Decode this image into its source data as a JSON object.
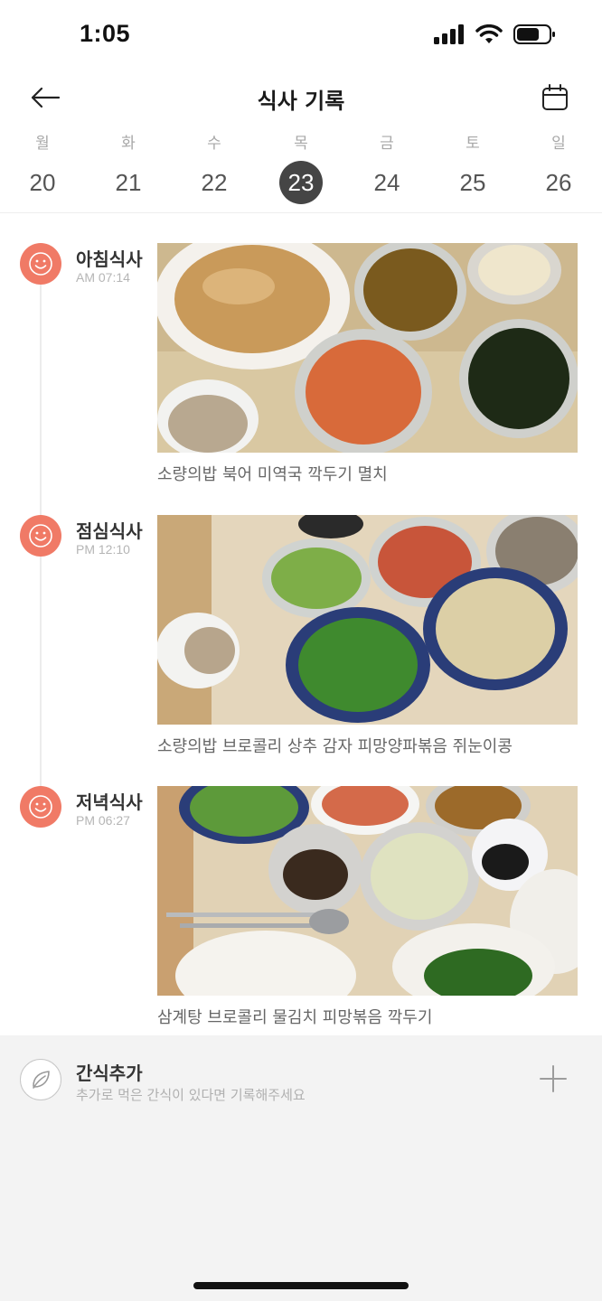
{
  "status_bar": {
    "time": "1:05"
  },
  "header": {
    "title": "식사 기록",
    "back_icon": "arrow-left-icon",
    "calendar_icon": "calendar-icon"
  },
  "week": {
    "days": [
      {
        "dow": "월",
        "date": "20",
        "selected": false
      },
      {
        "dow": "화",
        "date": "21",
        "selected": false
      },
      {
        "dow": "수",
        "date": "22",
        "selected": false
      },
      {
        "dow": "목",
        "date": "23",
        "selected": true
      },
      {
        "dow": "금",
        "date": "24",
        "selected": false
      },
      {
        "dow": "토",
        "date": "25",
        "selected": false
      },
      {
        "dow": "일",
        "date": "26",
        "selected": false
      }
    ]
  },
  "meals": [
    {
      "name": "아침식사",
      "time": "AM 07:14",
      "foods": "소량의밥 북어 미역국 깍두기 멸치",
      "icon": "smiley-icon"
    },
    {
      "name": "점심식사",
      "time": "PM 12:10",
      "foods": "소량의밥 브로콜리 상추 감자 피망양파볶음 쥐눈이콩",
      "icon": "smiley-icon"
    },
    {
      "name": "저녁식사",
      "time": "PM 06:27",
      "foods": "삼계탕 브로콜리 물김치 피망볶음 깍두기",
      "icon": "smiley-icon"
    }
  ],
  "snack": {
    "title": "간식추가",
    "subtitle": "추가로 먹은 간식이 있다면 기록해주세요",
    "icon": "leaf-icon",
    "add_icon": "plus-icon"
  },
  "colors": {
    "accent": "#f07a66",
    "selected_day": "#454545",
    "snack_bg": "#f3f3f3"
  }
}
